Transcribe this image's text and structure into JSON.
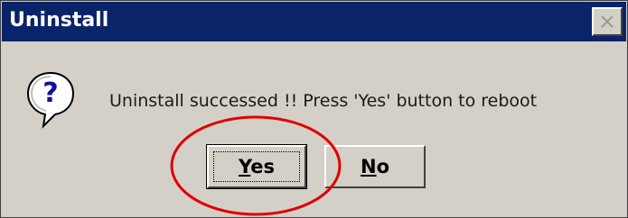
{
  "window": {
    "title": "Uninstall"
  },
  "dialog": {
    "icon": "question-icon",
    "message": "Uninstall successed !! Press 'Yes' button to reboot",
    "buttons": {
      "yes": {
        "mnemonic": "Y",
        "rest": "es"
      },
      "no": {
        "mnemonic": "N",
        "rest": "o"
      }
    }
  },
  "colors": {
    "titlebar": "#0a246a",
    "dialog_face": "#d4d0c8",
    "annotation_circle": "#e00000"
  },
  "titlebar_controls": {
    "close": "close-icon"
  }
}
